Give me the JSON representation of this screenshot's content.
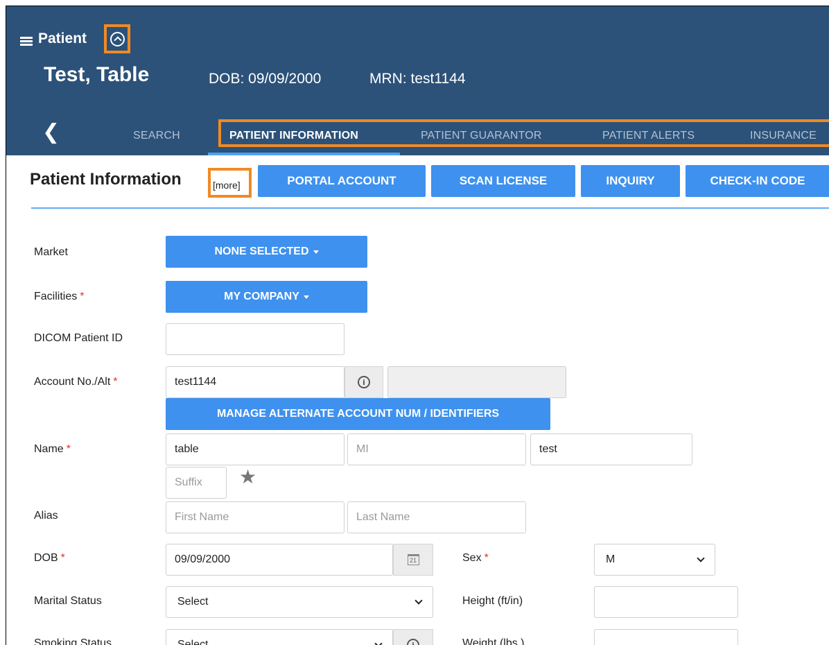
{
  "header": {
    "patient_label": "Patient",
    "name": "Test, Table",
    "dob": "DOB: 09/09/2000",
    "mrn": "MRN: test1144",
    "back_icon": "chevron-left-icon",
    "menu_icon": "hamburger-icon",
    "collapse_icon": "chevron-up-circle-icon"
  },
  "tabs": {
    "search": "SEARCH",
    "patient_information": "PATIENT INFORMATION",
    "patient_guarantor": "PATIENT GUARANTOR",
    "patient_alerts": "PATIENT ALERTS",
    "insurance": "INSURANCE"
  },
  "section": {
    "title": "Patient Information",
    "more": "[more]",
    "portal_account": "PORTAL ACCOUNT",
    "scan_license": "SCAN LICENSE",
    "inquiry": "INQUIRY",
    "check_in_code": "CHECK-IN CODE"
  },
  "form": {
    "market_label": "Market",
    "market_value": "NONE SELECTED",
    "facilities_label": "Facilities",
    "facilities_value": "MY COMPANY",
    "dicom_label": "DICOM Patient ID",
    "dicom_value": "",
    "account_label": "Account No./Alt",
    "account_value": "test1144",
    "account_alt_value": "",
    "manage_alt_button": "MANAGE ALTERNATE ACCOUNT NUM / IDENTIFIERS",
    "name_label": "Name",
    "first_name": "table",
    "mi_placeholder": "MI",
    "last_name": "test",
    "suffix_placeholder": "Suffix",
    "alias_label": "Alias",
    "alias_first_placeholder": "First Name",
    "alias_last_placeholder": "Last Name",
    "dob_label": "DOB",
    "dob_value": "09/09/2000",
    "calendar_day": "21",
    "sex_label": "Sex",
    "sex_value": "M",
    "marital_label": "Marital Status",
    "marital_value": "Select",
    "height_label": "Height (ft/in)",
    "height_value": "",
    "smoking_label": "Smoking Status",
    "smoking_value": "Select",
    "weight_label": "Weight (lbs.)",
    "weight_value": "",
    "required_mark": "*",
    "info_glyph": "i"
  },
  "colors": {
    "header_bg": "#2c5279",
    "primary_button": "#3e91ee",
    "highlight": "#f08a24",
    "required": "#e53030"
  }
}
